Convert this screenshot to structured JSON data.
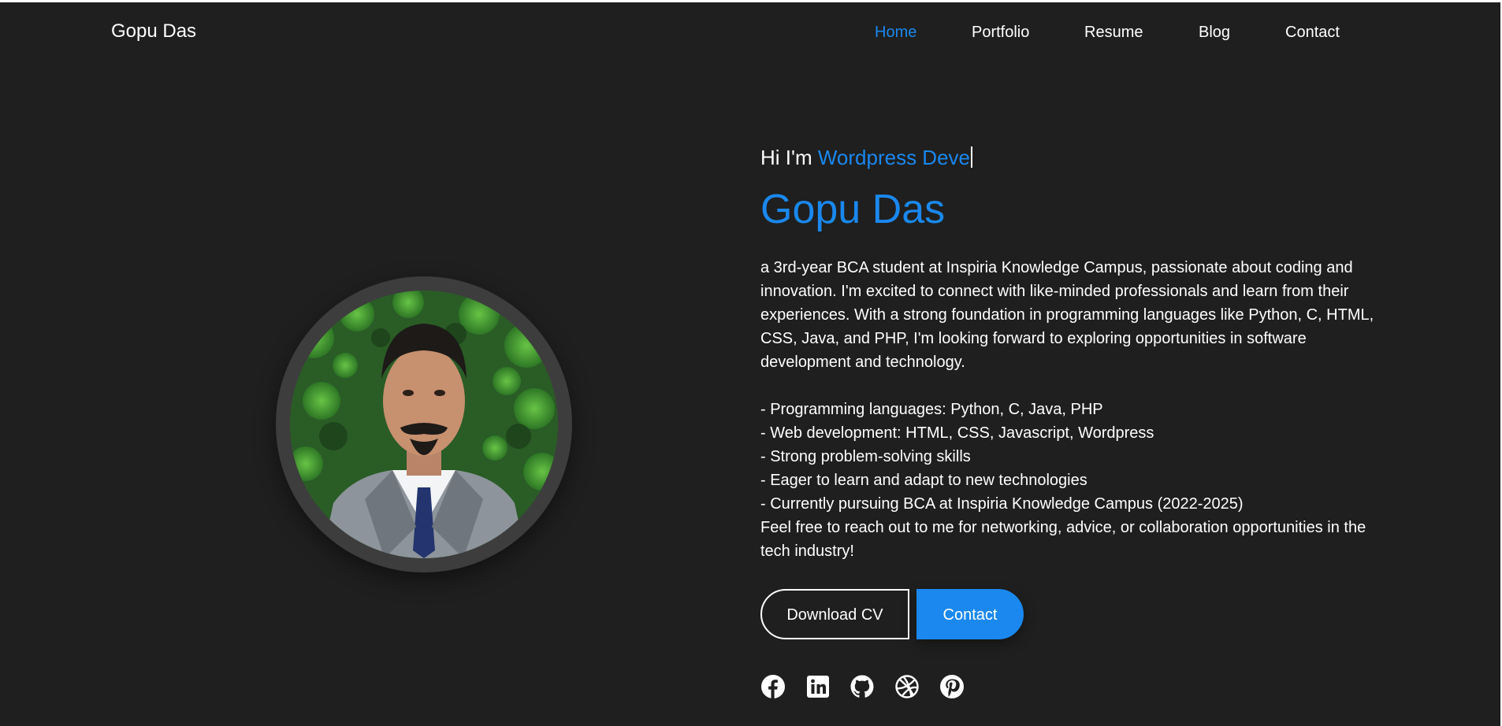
{
  "brand": "Gopu Das",
  "nav": {
    "items": [
      {
        "label": "Home"
      },
      {
        "label": "Portfolio"
      },
      {
        "label": "Resume"
      },
      {
        "label": "Blog"
      },
      {
        "label": "Contact"
      }
    ],
    "active": "Home"
  },
  "hero": {
    "greeting": "Hi I'm",
    "typed_role": "Wordpress Deve",
    "name": "Gopu Das",
    "bio": "a 3rd-year BCA student at Inspiria Knowledge Campus, passionate about coding and innovation. I'm excited to connect with like-minded professionals and learn from their experiences. With a strong foundation in programming languages like Python, C, HTML, CSS, Java, and PHP, I'm looking forward to exploring opportunities in software development and technology.",
    "skills": [
      "- Programming languages: Python, C, Java, PHP",
      "- Web development: HTML, CSS, Javascript, Wordpress",
      "- Strong problem-solving skills",
      "- Eager to learn and adapt to new technologies",
      "- Currently pursuing BCA at Inspiria Knowledge Campus (2022-2025)"
    ],
    "closing": "Feel free to reach out to me for networking, advice, or collaboration opportunities in the tech industry!",
    "buttons": {
      "download_cv": "Download CV",
      "contact": "Contact"
    }
  },
  "social": [
    {
      "icon": "facebook-icon"
    },
    {
      "icon": "linkedin-icon"
    },
    {
      "icon": "github-icon"
    },
    {
      "icon": "dribbble-icon"
    },
    {
      "icon": "pinterest-icon"
    }
  ],
  "colors": {
    "background": "#1f1f1f",
    "accent": "#1a88ef",
    "text": "#ffffff",
    "avatar_ring": "#3d3d3d"
  }
}
